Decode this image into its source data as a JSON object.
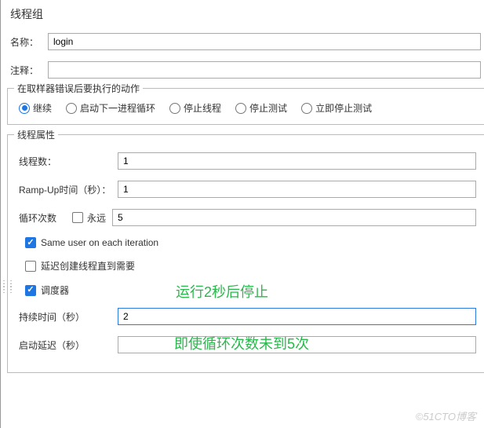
{
  "panel_title": "线程组",
  "name_label": "名称：",
  "name_value": "login",
  "comment_label": "注释：",
  "comment_value": "",
  "error_action": {
    "legend": "在取样器错误后要执行的动作",
    "options": [
      "继续",
      "启动下一进程循环",
      "停止线程",
      "停止测试",
      "立即停止测试"
    ],
    "selected": 0
  },
  "thread_props": {
    "legend": "线程属性",
    "threads_label": "线程数：",
    "threads_value": "1",
    "rampup_label": "Ramp-Up时间（秒）：",
    "rampup_value": "1",
    "loop_label": "循环次数",
    "loop_forever_label": "永远",
    "loop_forever_checked": false,
    "loop_value": "5",
    "same_user_label": "Same user on each iteration",
    "same_user_checked": true,
    "delay_create_label": "延迟创建线程直到需要",
    "delay_create_checked": false,
    "scheduler_label": "调度器",
    "scheduler_checked": true,
    "duration_label": "持续时间（秒）",
    "duration_value": "2",
    "startup_delay_label": "启动延迟（秒）",
    "startup_delay_value": ""
  },
  "annotations": {
    "a1": "运行2秒后停止",
    "a2": "即使循环次数未到5次"
  },
  "watermark": "©51CTO博客"
}
